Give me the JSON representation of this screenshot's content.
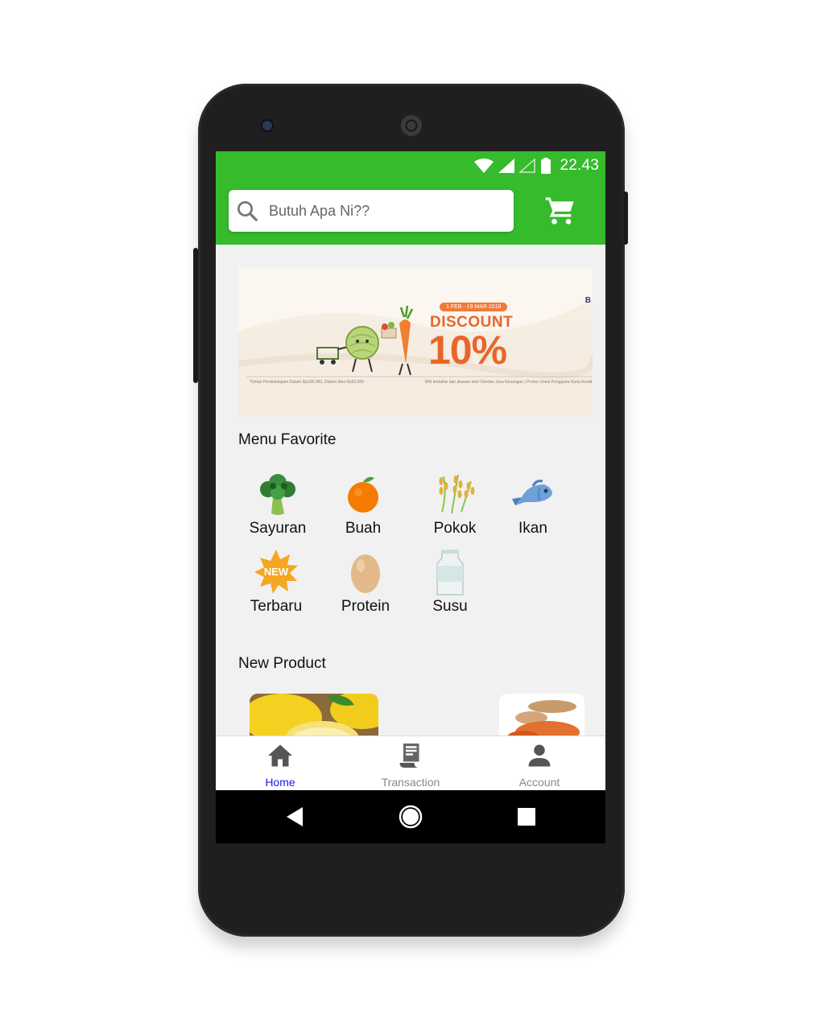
{
  "status_bar": {
    "time": "22.43"
  },
  "search": {
    "placeholder": "Butuh Apa Ni??"
  },
  "banner": {
    "badge": "1 FEB - 19 MAR 2018",
    "headline": "DISCOUNT",
    "percent": "10%",
    "fine_print_left": "*Untuk Pembelanjaan Dalam Rp100.000, Diskon Max Rp20.000",
    "fine_print_right": "BRI terdaftar dan diawasi oleh Otoritas Jasa Keuangan | Promo Untuk Pengguna Kartu Kredit",
    "logo": "B"
  },
  "menu_favorite": {
    "title": "Menu Favorite",
    "items": [
      {
        "label": "Sayuran",
        "icon": "broccoli-icon"
      },
      {
        "label": "Buah",
        "icon": "orange-icon"
      },
      {
        "label": "Pokok",
        "icon": "rice-icon"
      },
      {
        "label": "Ikan",
        "icon": "fish-icon"
      },
      {
        "label": "Terbaru",
        "icon": "new-badge-icon",
        "badge_text": "NEW"
      },
      {
        "label": "Protein",
        "icon": "egg-icon"
      },
      {
        "label": "Susu",
        "icon": "milk-icon"
      }
    ]
  },
  "new_product": {
    "title": "New Product"
  },
  "bottom_nav": {
    "items": [
      {
        "label": "Home",
        "icon": "home-icon",
        "active": true
      },
      {
        "label": "Transaction",
        "icon": "receipt-icon",
        "active": false
      },
      {
        "label": "Account",
        "icon": "person-icon",
        "active": false
      }
    ]
  },
  "colors": {
    "primary_green": "#35bb2c",
    "active_nav": "#1a1ae6",
    "inactive_nav": "#888888",
    "banner_accent": "#e8662b"
  }
}
